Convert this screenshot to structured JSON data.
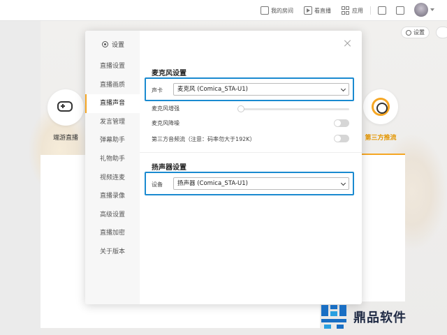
{
  "topbar": {
    "my_room": "我的房间",
    "watch_live": "看直播",
    "apps": "应用"
  },
  "background": {
    "settings_button": "设置",
    "game_live_label": "端游直播",
    "third_party_label": "第三方推流"
  },
  "dialog": {
    "title": "设置",
    "nav": [
      "直播设置",
      "直播画质",
      "直播声音",
      "发言管理",
      "弹幕助手",
      "礼物助手",
      "视频连麦",
      "直播录像",
      "高级设置",
      "直播加密",
      "关于版本"
    ],
    "active_nav_index": 2,
    "mic_section": {
      "title": "麦克风设置",
      "sound_card_label": "声卡",
      "sound_card_value": "麦克风 (Comica_STA-U1)",
      "boost_label": "麦克风增强",
      "boost_level": 0,
      "noise_label": "麦克风降噪",
      "noise_enabled": false,
      "third_party_label": "第三方音频流（注意：码率勿大于192K）",
      "third_party_enabled": false
    },
    "speaker_section": {
      "title": "扬声器设置",
      "device_label": "设备",
      "device_value": "扬声器 (Comica_STA-U1)"
    }
  },
  "watermark": {
    "text": "鼎品软件"
  },
  "colors": {
    "accent": "#f5a623",
    "highlight": "#1a8ad0"
  }
}
